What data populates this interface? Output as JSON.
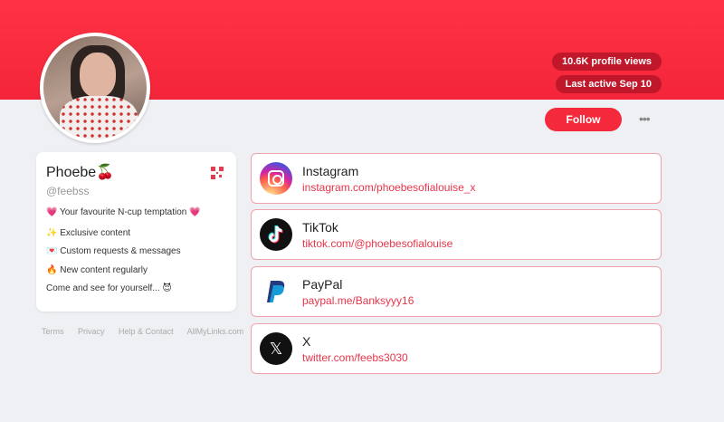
{
  "profile": {
    "display_name": "Phoebe🍒",
    "handle": "@feebss",
    "bio": [
      "💗 Your favourite N-cup temptation 💗",
      "✨ Exclusive content",
      "💌 Custom requests & messages",
      "🔥 New content regularly",
      "Come and see for yourself... 😈"
    ]
  },
  "stats": {
    "views": "10.6K profile views",
    "last_active": "Last active Sep 10"
  },
  "actions": {
    "follow_label": "Follow",
    "more_label": "•••"
  },
  "links": [
    {
      "title": "Instagram",
      "url": "instagram.com/phoebesofialouise_x",
      "icon": "instagram-icon"
    },
    {
      "title": "TikTok",
      "url": "tiktok.com/@phoebesofialouise",
      "icon": "tiktok-icon"
    },
    {
      "title": "PayPal",
      "url": "paypal.me/Banksyyy16",
      "icon": "paypal-icon"
    },
    {
      "title": "X",
      "url": "twitter.com/feebs3030",
      "icon": "x-icon"
    }
  ],
  "footer": [
    "Terms",
    "Privacy",
    "Help & Contact",
    "AllMyLinks.com"
  ],
  "colors": {
    "accent": "#f42a3c",
    "banner": "#f4253a",
    "pill": "#c0172b",
    "link_border": "#f1a3ad",
    "link_url": "#e8354a"
  }
}
